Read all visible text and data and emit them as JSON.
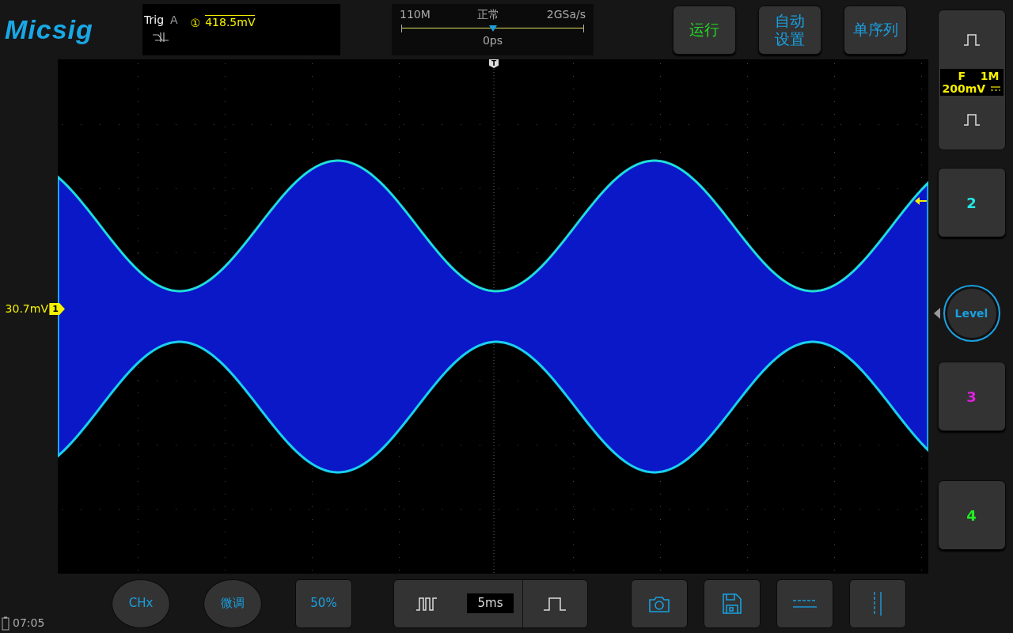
{
  "logo": "Micsig",
  "trigger": {
    "label": "Trig",
    "mode": "A",
    "source": "①",
    "level": "418.5mV"
  },
  "acquisition": {
    "bandwidth": "110M",
    "mode": "正常",
    "sample_rate": "2GSa/s",
    "delay": "0ps",
    "level": 0.5
  },
  "top_buttons": [
    {
      "lines": [
        "运行"
      ],
      "kind": "run"
    },
    {
      "lines": [
        "自动",
        "设置"
      ],
      "kind": "action"
    },
    {
      "lines": [
        "单序列"
      ],
      "kind": "action"
    }
  ],
  "trigger_marker": "T",
  "offset": {
    "reading": "30.7mV",
    "channel": "1"
  },
  "channel1": {
    "coupling": "F",
    "impedance": "1M",
    "scale": "200mV"
  },
  "channels": [
    {
      "label": "2",
      "color": "#22e8e8"
    },
    {
      "label": "3",
      "color": "#e020e0"
    },
    {
      "label": "4",
      "color": "#22ee22"
    }
  ],
  "level_knob": {
    "label": "Level",
    "selected": true
  },
  "bottom": {
    "chx": "CHx",
    "fine": "微调",
    "fifty": "50%",
    "timebase": "5ms"
  },
  "clock": "07:05"
}
